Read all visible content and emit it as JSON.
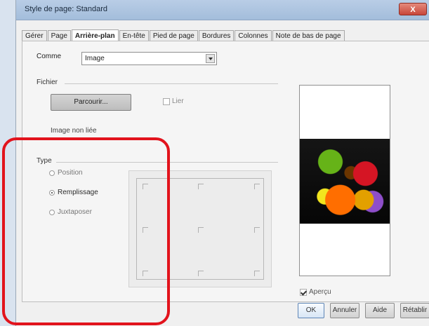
{
  "window": {
    "title": "Style de page: Standard",
    "close_label": "X"
  },
  "tabs": [
    {
      "label": "Gérer"
    },
    {
      "label": "Page"
    },
    {
      "label": "Arrière-plan"
    },
    {
      "label": "En-tête"
    },
    {
      "label": "Pied de page"
    },
    {
      "label": "Bordures"
    },
    {
      "label": "Colonnes"
    },
    {
      "label": "Note de bas de page"
    }
  ],
  "fields": {
    "as_label": "Comme",
    "as_value": "Image",
    "file_section": "Fichier",
    "browse_button": "Parcourir...",
    "link_label": "Lier",
    "file_status": "Image non liée",
    "type_section": "Type"
  },
  "type_options": [
    {
      "label": "Position",
      "selected": false
    },
    {
      "label": "Remplissage",
      "selected": true
    },
    {
      "label": "Juxtaposer",
      "selected": false
    }
  ],
  "preview": {
    "checkbox_label": "Aperçu",
    "checked": true
  },
  "buttons": {
    "ok": "OK",
    "cancel": "Annuler",
    "help": "Aide",
    "reset": "Rétablir"
  },
  "colors": {
    "highlight_outline": "#e2131c",
    "window_chrome": "#b9cde6",
    "preview_background": "#060606"
  }
}
